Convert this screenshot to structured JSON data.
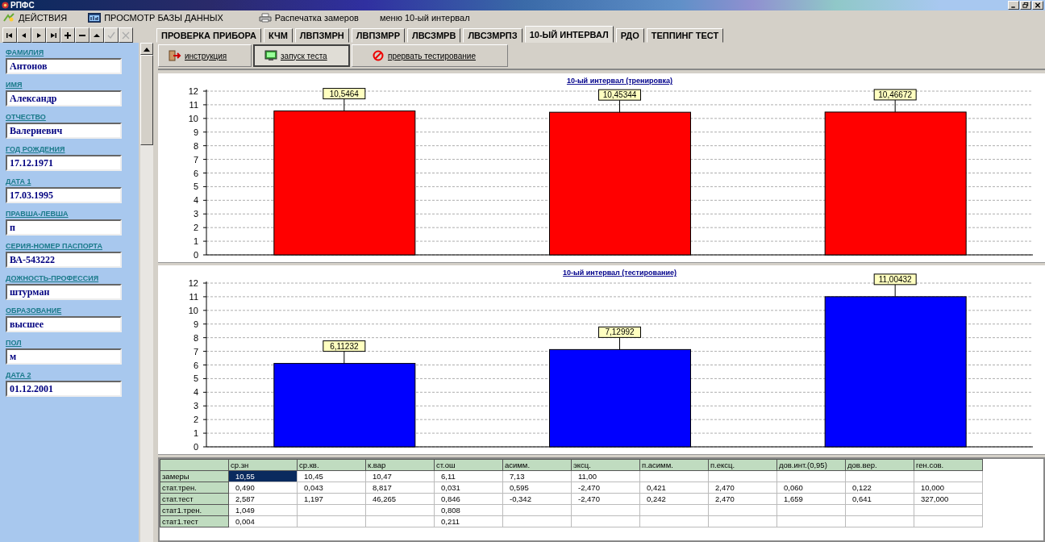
{
  "window": {
    "title": "РПФС"
  },
  "menu": [
    {
      "label": "ДЕЙСТВИЯ",
      "kind": "actions"
    },
    {
      "label": "ПРОСМОТР БАЗЫ ДАННЫХ",
      "kind": "database"
    },
    {
      "label": "Распечатка замеров",
      "kind": "printer"
    },
    {
      "label": "меню 10-ый интервал",
      "kind": "plain"
    }
  ],
  "nav_buttons": [
    {
      "kind": "first",
      "disabled": false
    },
    {
      "kind": "prev",
      "disabled": false
    },
    {
      "kind": "next",
      "disabled": false
    },
    {
      "kind": "last",
      "disabled": false
    },
    {
      "kind": "add",
      "disabled": false
    },
    {
      "kind": "remove",
      "disabled": false
    },
    {
      "kind": "up",
      "disabled": false
    },
    {
      "kind": "confirm",
      "disabled": true
    },
    {
      "kind": "cancel",
      "disabled": true
    }
  ],
  "tabs": [
    {
      "label": "ПРОВЕРКА ПРИБОРА",
      "selected": false
    },
    {
      "label": "КЧМ",
      "selected": false
    },
    {
      "label": "ЛВПЗМРН",
      "selected": false
    },
    {
      "label": "ЛВПЗМРР",
      "selected": false
    },
    {
      "label": "ЛВСЗМРВ",
      "selected": false
    },
    {
      "label": "ЛВСЗМРПЗ",
      "selected": false
    },
    {
      "label": "10-ЫЙ ИНТЕРВАЛ",
      "selected": true
    },
    {
      "label": "РДО",
      "selected": false
    },
    {
      "label": "ТЕППИНГ ТЕСТ",
      "selected": false
    }
  ],
  "fields": [
    {
      "label": "ФАМИЛИЯ",
      "value": "Антонов"
    },
    {
      "label": "ИМЯ",
      "value": "Александр"
    },
    {
      "label": "ОТЧЕСТВО",
      "value": "Валериевич"
    },
    {
      "label": "ГОД РОЖДЕНИЯ",
      "value": "17.12.1971"
    },
    {
      "label": "ДАТА 1",
      "value": "17.03.1995"
    },
    {
      "label": "ПРАВША-ЛЕВША",
      "value": "п"
    },
    {
      "label": "СЕРИЯ-НОМЕР ПАСПОРТА",
      "value": "ВА-543222"
    },
    {
      "label": "ДОЖНОСТЬ-ПРОФЕССИЯ",
      "value": "штурман"
    },
    {
      "label": "ОБРАЗОВАНИЕ",
      "value": "высшее"
    },
    {
      "label": "ПОЛ",
      "value": "м"
    },
    {
      "label": "ДАТА 2",
      "value": "01.12.2001"
    }
  ],
  "actions": [
    {
      "label": "инструкция",
      "kind": "exit",
      "pressed": false
    },
    {
      "label": "запуск теста",
      "kind": "monitor",
      "pressed": true
    },
    {
      "label": "прервать тестирование",
      "kind": "stop",
      "pressed": false
    }
  ],
  "charts": [
    {
      "chart_data": {
        "type": "bar",
        "grid": true,
        "title": "10-ый интервал (тренировка)",
        "series": [
          {
            "color": "#ff0000",
            "values": [
              10.5464,
              10.45344,
              10.46672
            ]
          }
        ],
        "ylim": [
          0,
          12
        ],
        "yticks": [
          0,
          1,
          2,
          3,
          4,
          5,
          6,
          7,
          8,
          9,
          10,
          11,
          12
        ],
        "value_labels": [
          "10,5464",
          "10,45344",
          "10,46672"
        ]
      }
    },
    {
      "chart_data": {
        "type": "bar",
        "grid": true,
        "title": "10-ый интервал (тестирование)",
        "series": [
          {
            "color": "#0000ff",
            "values": [
              6.11232,
              7.12992,
              11.00432
            ]
          }
        ],
        "ylim": [
          0,
          12
        ],
        "yticks": [
          0,
          1,
          2,
          3,
          4,
          5,
          6,
          7,
          8,
          9,
          10,
          11,
          12
        ],
        "value_labels": [
          "6,11232",
          "7,12992",
          "11,00432"
        ]
      }
    }
  ],
  "table": {
    "columns": [
      "ср.зн",
      "ср.кв.",
      "к.вар",
      "ст.ош",
      "асимм.",
      "эксц.",
      "п.асимм.",
      "п.ексц.",
      "дов.инт.(0,95)",
      "дов.вер.",
      "ген.сов."
    ],
    "rows": [
      {
        "label": "замеры",
        "cells": [
          {
            "text": "10,55",
            "selected": true
          },
          {
            "text": "10,45",
            "selected": false
          },
          {
            "text": "10,47",
            "selected": false
          },
          {
            "text": "6,11",
            "selected": false
          },
          {
            "text": "7,13",
            "selected": false
          },
          {
            "text": "11,00",
            "selected": false
          },
          {
            "selected": false
          },
          {
            "selected": false
          },
          {
            "selected": false
          },
          {
            "selected": false
          },
          {
            "selected": false
          }
        ]
      },
      {
        "label": "стат.трен.",
        "cells": [
          {
            "text": "0,490",
            "selected": false
          },
          {
            "text": "0,043",
            "selected": false
          },
          {
            "text": "8,817",
            "selected": false
          },
          {
            "text": "0,031",
            "selected": false
          },
          {
            "text": "0,595",
            "selected": false
          },
          {
            "text": "-2,470",
            "selected": false
          },
          {
            "text": "0,421",
            "selected": false
          },
          {
            "text": "2,470",
            "selected": false
          },
          {
            "text": "0,060",
            "selected": false
          },
          {
            "text": "0,122",
            "selected": false
          },
          {
            "text": "10,000",
            "selected": false
          }
        ]
      },
      {
        "label": "стат.тест",
        "cells": [
          {
            "text": "2,587",
            "selected": false
          },
          {
            "text": "1,197",
            "selected": false
          },
          {
            "text": "46,265",
            "selected": false
          },
          {
            "text": "0,846",
            "selected": false
          },
          {
            "text": "-0,342",
            "selected": false
          },
          {
            "text": "-2,470",
            "selected": false
          },
          {
            "text": "0,242",
            "selected": false
          },
          {
            "text": "2,470",
            "selected": false
          },
          {
            "text": "1,659",
            "selected": false
          },
          {
            "text": "0,641",
            "selected": false
          },
          {
            "text": "327,000",
            "selected": false
          }
        ]
      },
      {
        "label": "стат1.трен.",
        "cells": [
          {
            "text": "1,049",
            "selected": false
          },
          {
            "selected": false
          },
          {
            "selected": false
          },
          {
            "text": "0,808",
            "selected": false
          },
          {
            "selected": false
          },
          {
            "selected": false
          },
          {
            "selected": false
          },
          {
            "selected": false
          },
          {
            "selected": false
          },
          {
            "selected": false
          },
          {
            "selected": false
          }
        ]
      },
      {
        "label": "стат1.тест",
        "cells": [
          {
            "text": "0,004",
            "selected": false
          },
          {
            "selected": false
          },
          {
            "selected": false
          },
          {
            "text": "0,211",
            "selected": false
          },
          {
            "selected": false
          },
          {
            "selected": false
          },
          {
            "selected": false
          },
          {
            "selected": false
          },
          {
            "selected": false
          },
          {
            "selected": false
          },
          {
            "selected": false
          }
        ]
      }
    ]
  }
}
